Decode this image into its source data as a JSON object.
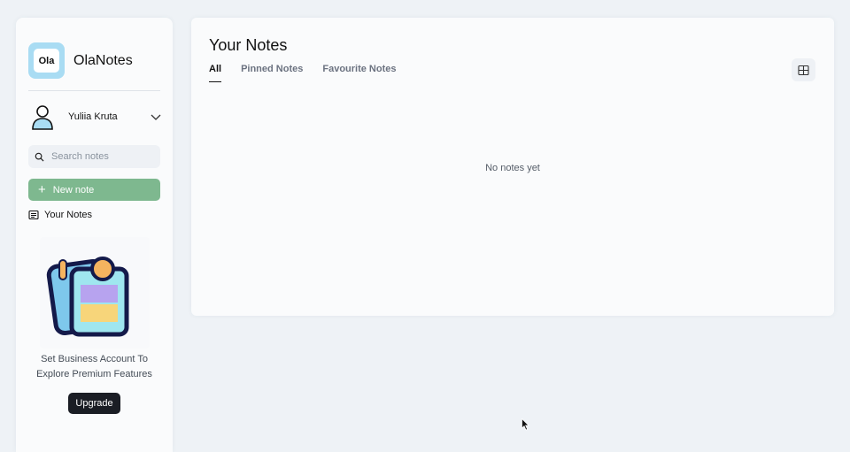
{
  "sidebar": {
    "logo_text": "Ola",
    "app_name": "OlaNotes",
    "user": {
      "name": "Yuliia Kruta"
    },
    "search": {
      "placeholder": "Search notes"
    },
    "new_note_label": "New note",
    "nav": [
      {
        "label": "Your Notes",
        "icon": "notes-icon"
      }
    ],
    "promo": {
      "line1": "Set Business Account To",
      "line2": "Explore Premium Features",
      "button_label": "Upgrade"
    }
  },
  "main": {
    "title": "Your Notes",
    "tabs": [
      {
        "label": "All",
        "active": true
      },
      {
        "label": "Pinned Notes",
        "active": false
      },
      {
        "label": "Favourite Notes",
        "active": false
      }
    ],
    "view_toggle_icon": "grid-view-icon",
    "empty_message": "No notes yet"
  },
  "colors": {
    "accent_green": "#7eb88f",
    "logo_bg": "#a9dcf3",
    "dark_button": "#1a1d24"
  }
}
